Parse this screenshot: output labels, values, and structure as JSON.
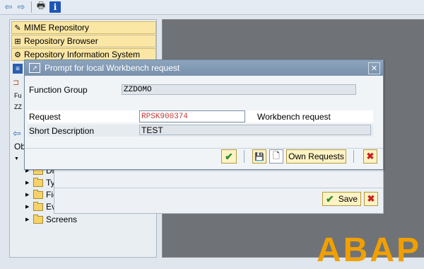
{
  "toolbar": {
    "back_icon": "back-arrow-icon",
    "forward_icon": "forward-arrow-icon",
    "print_icon": "print-icon",
    "info_label": "i"
  },
  "nav": {
    "items": [
      {
        "label": "MIME Repository",
        "icon": "mime-icon"
      },
      {
        "label": "Repository Browser",
        "icon": "browser-icon"
      },
      {
        "label": "Repository Information System",
        "icon": "info-system-icon"
      }
    ],
    "partial_labels": [
      "Fu",
      "ZZ",
      "Ob"
    ],
    "tree": [
      {
        "label": "Dic"
      },
      {
        "label": "Typ"
      },
      {
        "label": "Fie"
      },
      {
        "label": "Eve"
      },
      {
        "label": "Screens"
      }
    ]
  },
  "workarea": {
    "logo_text": "ABAP"
  },
  "dialog": {
    "title": "Prompt for local Workbench request",
    "function_group_label": "Function Group",
    "function_group_value": "ZZDOMO",
    "request_label": "Request",
    "request_value": "RPSK900374",
    "request_type": "Workbench request",
    "short_description_label": "Short Description",
    "short_description_value": "TEST",
    "own_requests_label": "Own Requests"
  },
  "back_dialog": {
    "save_label": "Save"
  },
  "colors": {
    "accent": "#fbe7a5",
    "title_bar": "#7f95b0",
    "request_text": "#c43b3b",
    "logo": "#f0a000"
  }
}
